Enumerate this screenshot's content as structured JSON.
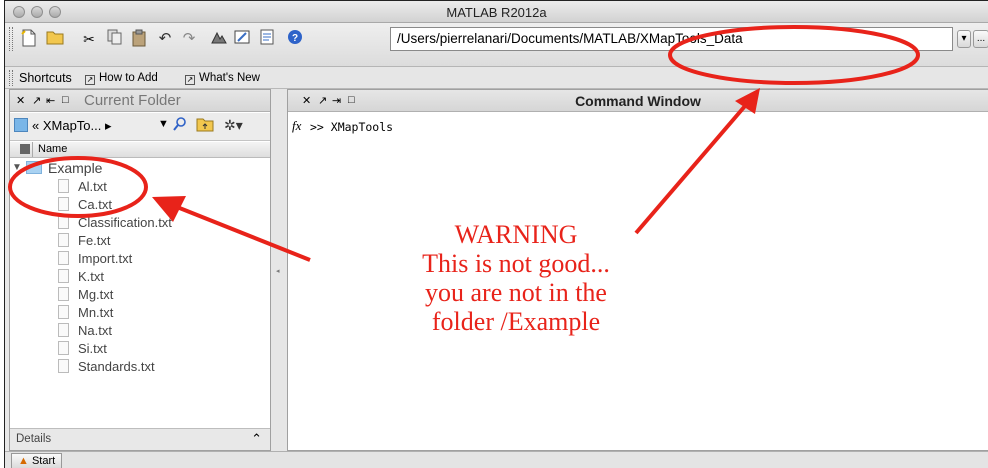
{
  "window": {
    "title": "MATLAB  R2012a"
  },
  "toolbar": {
    "current_path": "/Users/pierrelanari/Documents/MATLAB/XMapTools_Data",
    "browse_label": "...",
    "icons": [
      "new-file-icon",
      "open-folder-icon",
      "cut-icon",
      "copy-icon",
      "paste-icon",
      "undo-icon",
      "redo-icon",
      "simulink-icon",
      "guide-icon",
      "profiler-icon",
      "help-icon"
    ]
  },
  "shortcuts": {
    "label": "Shortcuts",
    "how_to_add": "How to Add",
    "whats_new": "What's New"
  },
  "current_folder": {
    "title": "Current Folder",
    "folder_combo": "« XMapTo... ▸",
    "column_name": "Name",
    "folder": "Example",
    "files": [
      "Al.txt",
      "Ca.txt",
      "Classification.txt",
      "Fe.txt",
      "Import.txt",
      "K.txt",
      "Mg.txt",
      "Mn.txt",
      "Na.txt",
      "Si.txt",
      "Standards.txt"
    ],
    "details_label": "Details"
  },
  "command_window": {
    "title": "Command Window",
    "fx": "fx",
    "command": ">> XMapTools"
  },
  "statusbar": {
    "start_label": "Start"
  },
  "annotation": {
    "color": "#e8231a",
    "lines": [
      "WARNING",
      "This is not good...",
      "you are not in the",
      "folder /Example"
    ]
  }
}
